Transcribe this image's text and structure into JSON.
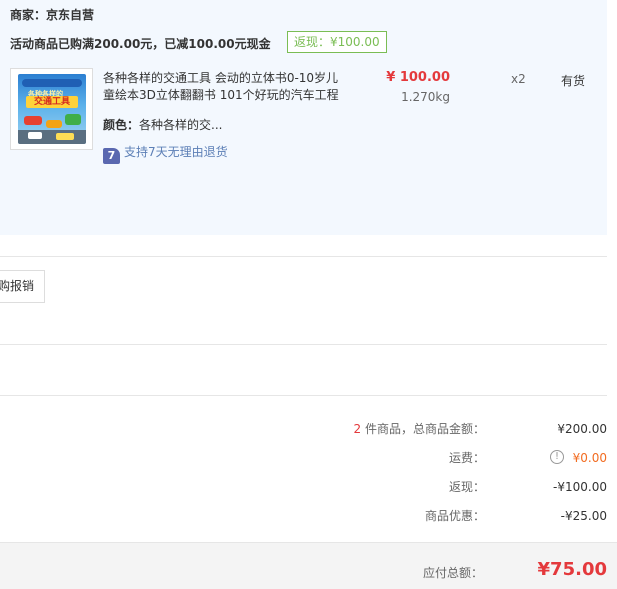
{
  "shop": {
    "merchant_label": "商家：京东自营",
    "promo_text": "活动商品已购满200.00元，已减100.00元现金",
    "cashback_badge": "返现：¥100.00"
  },
  "product": {
    "image_icon": "book-cover-image",
    "cover_line1": "各种各样的",
    "cover_line2": "交通工具",
    "title": "各种各样的交通工具 会动的立体书0-10岁儿童绘本3D立体翻翻书 101个好玩的汽车工程",
    "color_label": "颜色：",
    "color_value": "各种各样的交...",
    "return_icon": "7",
    "return_text": "支持7天无理由退货",
    "price": "¥ 100.00",
    "weight": "1.270kg",
    "quantity": "x2",
    "stock": "有货"
  },
  "invoice": {
    "button_label": "购报销"
  },
  "summary": {
    "count": "2",
    "count_suffix": "件商品，总商品金额：",
    "goods_total": "¥200.00",
    "shipping_label": "运费：",
    "shipping_value": "¥0.00",
    "cashback_label": "返现：",
    "cashback_value": "-¥100.00",
    "discount_label": "商品优惠：",
    "discount_value": "-¥25.00"
  },
  "total": {
    "label": "应付总额：",
    "value": "¥75.00"
  },
  "colors": {
    "price_red": "#e4393c",
    "accent_orange": "#f26c21",
    "badge_green": "#7abd54",
    "panel_blue": "#f3f8fe",
    "link_blue": "#5c7fb6"
  }
}
